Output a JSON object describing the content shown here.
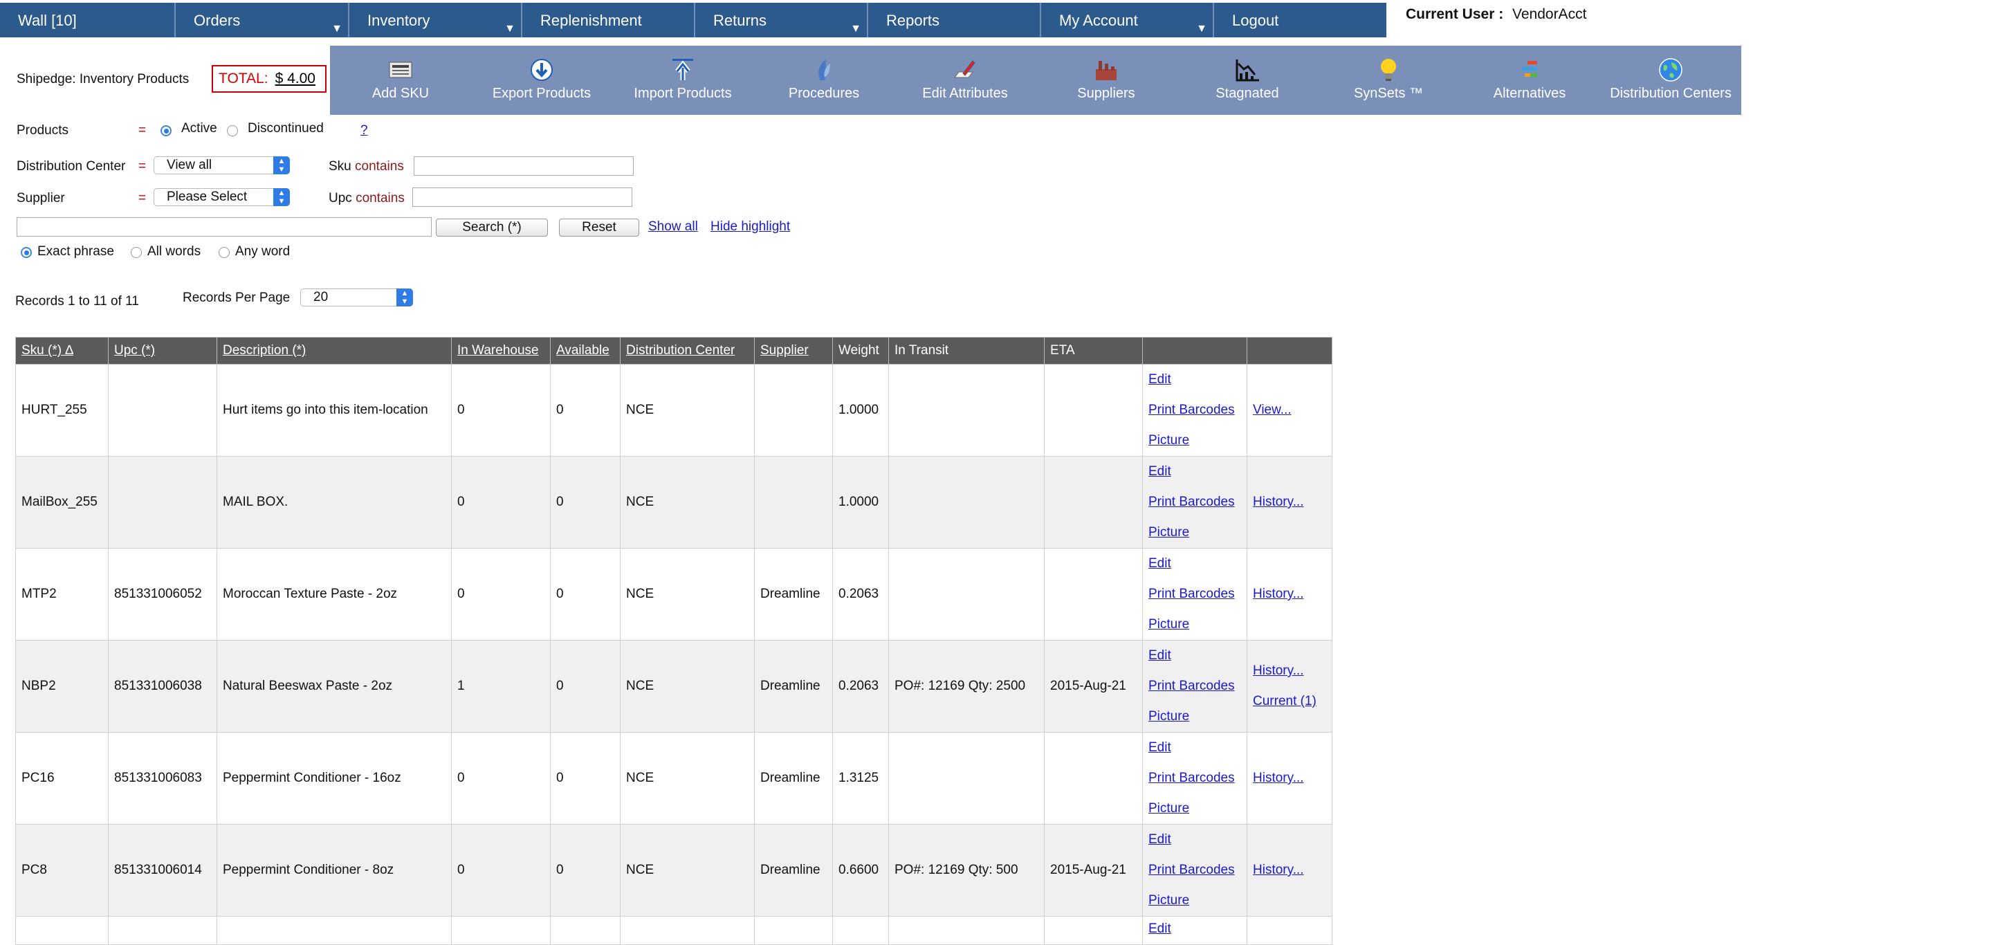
{
  "nav": {
    "items": [
      {
        "label": "Wall [10]",
        "dropdown": false
      },
      {
        "label": "Orders",
        "dropdown": true
      },
      {
        "label": "Inventory",
        "dropdown": true
      },
      {
        "label": "Replenishment",
        "dropdown": false
      },
      {
        "label": "Returns",
        "dropdown": true
      },
      {
        "label": "Reports",
        "dropdown": false
      },
      {
        "label": "My Account",
        "dropdown": true
      },
      {
        "label": "Logout",
        "dropdown": false
      }
    ],
    "dropdown_glyph": "▼"
  },
  "user": {
    "label": "Current User :",
    "value": "VendorAcct"
  },
  "page": {
    "title": "Shipedge: Inventory Products",
    "total_label": "TOTAL:",
    "total_value": "$ 4.00"
  },
  "toolbar": [
    {
      "label": "Add SKU",
      "icon": "add-sku-icon"
    },
    {
      "label": "Export Products",
      "icon": "export-icon"
    },
    {
      "label": "Import Products",
      "icon": "import-icon"
    },
    {
      "label": "Procedures",
      "icon": "procedures-icon"
    },
    {
      "label": "Edit Attributes",
      "icon": "edit-attributes-icon"
    },
    {
      "label": "Suppliers",
      "icon": "suppliers-icon"
    },
    {
      "label": "Stagnated",
      "icon": "stagnated-icon"
    },
    {
      "label": "SynSets ™",
      "icon": "bulb-icon"
    },
    {
      "label": "Alternatives",
      "icon": "alternatives-icon"
    },
    {
      "label": "Distribution Centers",
      "icon": "globe-icon"
    }
  ],
  "filters": {
    "products_label": "Products",
    "eq": "=",
    "active_label": "Active",
    "discontinued_label": "Discontinued",
    "help": "?",
    "dc_label": "Distribution Center",
    "dc_value": "View all",
    "supplier_label": "Supplier",
    "supplier_value": "Please Select",
    "sku_label": "Sku",
    "upc_label": "Upc",
    "contains": "contains",
    "sku_value": "",
    "upc_value": "",
    "search_value": "",
    "search_button": "Search (*)",
    "reset_button": "Reset",
    "show_all": "Show all",
    "hide_highlight": "Hide highlight",
    "exact_phrase": "Exact phrase",
    "all_words": "All words",
    "any_word": "Any word"
  },
  "records": {
    "summary": "Records 1 to 11 of 11",
    "per_page_label": "Records Per Page",
    "per_page_value": "20"
  },
  "table": {
    "headers": [
      "Sku (*)",
      "Upc (*)",
      "Description (*)",
      "In Warehouse",
      "Available",
      "Distribution Center",
      "Supplier",
      "Weight",
      "In Transit",
      "ETA",
      "",
      ""
    ],
    "sort_indicator": "∆",
    "rows": [
      {
        "sku": "HURT_255",
        "upc": "",
        "description": "Hurt items go into this item-location",
        "in_warehouse": "0",
        "available": "0",
        "dc": "NCE",
        "supplier": "",
        "weight": "1.0000",
        "in_transit": "",
        "eta": "",
        "actions": [
          "Edit",
          "Print Barcodes",
          "Picture"
        ],
        "extra": [
          "View..."
        ]
      },
      {
        "sku": "MailBox_255",
        "upc": "",
        "description": "MAIL BOX.",
        "in_warehouse": "0",
        "available": "0",
        "dc": "NCE",
        "supplier": "",
        "weight": "1.0000",
        "in_transit": "",
        "eta": "",
        "actions": [
          "Edit",
          "Print Barcodes",
          "Picture"
        ],
        "extra": [
          "History..."
        ]
      },
      {
        "sku": "MTP2",
        "upc": "851331006052",
        "description": "Moroccan Texture Paste - 2oz",
        "in_warehouse": "0",
        "available": "0",
        "dc": "NCE",
        "supplier": "Dreamline",
        "weight": "0.2063",
        "in_transit": "",
        "eta": "",
        "actions": [
          "Edit",
          "Print Barcodes",
          "Picture"
        ],
        "extra": [
          "History..."
        ]
      },
      {
        "sku": "NBP2",
        "upc": "851331006038",
        "description": "Natural Beeswax Paste - 2oz",
        "in_warehouse": "1",
        "available": "0",
        "dc": "NCE",
        "supplier": "Dreamline",
        "weight": "0.2063",
        "in_transit": "PO#: 12169 Qty: 2500",
        "eta": "2015-Aug-21",
        "actions": [
          "Edit",
          "Print Barcodes",
          "Picture"
        ],
        "extra": [
          "History...",
          "Current (1)"
        ]
      },
      {
        "sku": "PC16",
        "upc": "851331006083",
        "description": "Peppermint Conditioner - 16oz",
        "in_warehouse": "0",
        "available": "0",
        "dc": "NCE",
        "supplier": "Dreamline",
        "weight": "1.3125",
        "in_transit": "",
        "eta": "",
        "actions": [
          "Edit",
          "Print Barcodes",
          "Picture"
        ],
        "extra": [
          "History..."
        ]
      },
      {
        "sku": "PC8",
        "upc": "851331006014",
        "description": "Peppermint Conditioner - 8oz",
        "in_warehouse": "0",
        "available": "0",
        "dc": "NCE",
        "supplier": "Dreamline",
        "weight": "0.6600",
        "in_transit": "PO#: 12169 Qty: 500",
        "eta": "2015-Aug-21",
        "actions": [
          "Edit",
          "Print Barcodes",
          "Picture"
        ],
        "extra": [
          "History..."
        ]
      }
    ],
    "partial_row_action": "Edit"
  }
}
